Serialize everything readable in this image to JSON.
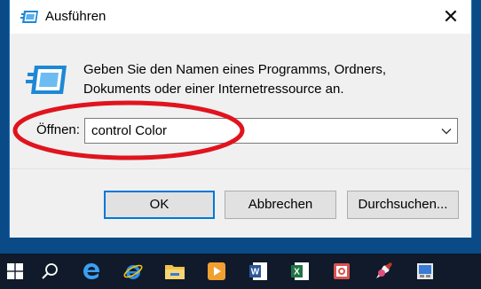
{
  "dialog": {
    "title": "Ausführen",
    "close_symbol": "✕",
    "description_line1": "Geben Sie den Namen eines Programms, Ordners,",
    "description_line2": "Dokuments oder einer Internetressource an.",
    "open_label": "Öffnen:",
    "open_value": "control Color",
    "buttons": {
      "ok": "OK",
      "cancel": "Abbrechen",
      "browse": "Durchsuchen..."
    }
  },
  "colors": {
    "accent": "#0078d7",
    "annotation": "#e0141e",
    "taskbar": "#101a2a",
    "desktop": "#0a4a86"
  },
  "taskbar": {
    "items": [
      {
        "name": "start",
        "icon": "windows-logo-icon"
      },
      {
        "name": "search",
        "icon": "search-icon"
      },
      {
        "name": "edge",
        "icon": "edge-icon"
      },
      {
        "name": "internet-explorer",
        "icon": "internet-explorer-icon"
      },
      {
        "name": "file-explorer",
        "icon": "folder-icon"
      },
      {
        "name": "media-player",
        "icon": "media-player-icon"
      },
      {
        "name": "word",
        "icon": "word-icon"
      },
      {
        "name": "excel",
        "icon": "excel-icon"
      },
      {
        "name": "snipping-tool",
        "icon": "snipping-tool-icon"
      },
      {
        "name": "paint",
        "icon": "paint-icon"
      },
      {
        "name": "control-panel",
        "icon": "control-panel-icon"
      }
    ]
  }
}
